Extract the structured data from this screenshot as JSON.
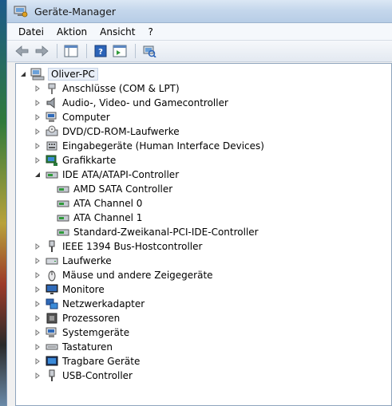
{
  "window": {
    "title": "Geräte-Manager"
  },
  "menu": [
    "Datei",
    "Aktion",
    "Ansicht",
    "?"
  ],
  "tree": {
    "root": "Oliver-PC",
    "categories": [
      {
        "label": "Anschlüsse (COM & LPT)",
        "icon": "port-icon"
      },
      {
        "label": "Audio-, Video- und Gamecontroller",
        "icon": "speaker-icon"
      },
      {
        "label": "Computer",
        "icon": "computer-icon"
      },
      {
        "label": "DVD/CD-ROM-Laufwerke",
        "icon": "dvd-drive-icon"
      },
      {
        "label": "Eingabegeräte (Human Interface Devices)",
        "icon": "hid-icon"
      },
      {
        "label": "Grafikkarte",
        "icon": "display-adapter-icon"
      },
      {
        "label": "IDE ATA/ATAPI-Controller",
        "icon": "ide-controller-icon",
        "expanded": true,
        "children": [
          "AMD SATA Controller",
          "ATA Channel 0",
          "ATA Channel 1",
          "Standard-Zweikanal-PCI-IDE-Controller"
        ]
      },
      {
        "label": "IEEE 1394 Bus-Hostcontroller",
        "icon": "firewire-icon"
      },
      {
        "label": "Laufwerke",
        "icon": "disk-drive-icon"
      },
      {
        "label": "Mäuse und andere Zeigegeräte",
        "icon": "mouse-icon"
      },
      {
        "label": "Monitore",
        "icon": "monitor-icon"
      },
      {
        "label": "Netzwerkadapter",
        "icon": "network-adapter-icon"
      },
      {
        "label": "Prozessoren",
        "icon": "processor-icon"
      },
      {
        "label": "Systemgeräte",
        "icon": "system-device-icon"
      },
      {
        "label": "Tastaturen",
        "icon": "keyboard-icon"
      },
      {
        "label": "Tragbare Geräte",
        "icon": "portable-device-icon"
      },
      {
        "label": "USB-Controller",
        "icon": "usb-icon"
      }
    ]
  }
}
